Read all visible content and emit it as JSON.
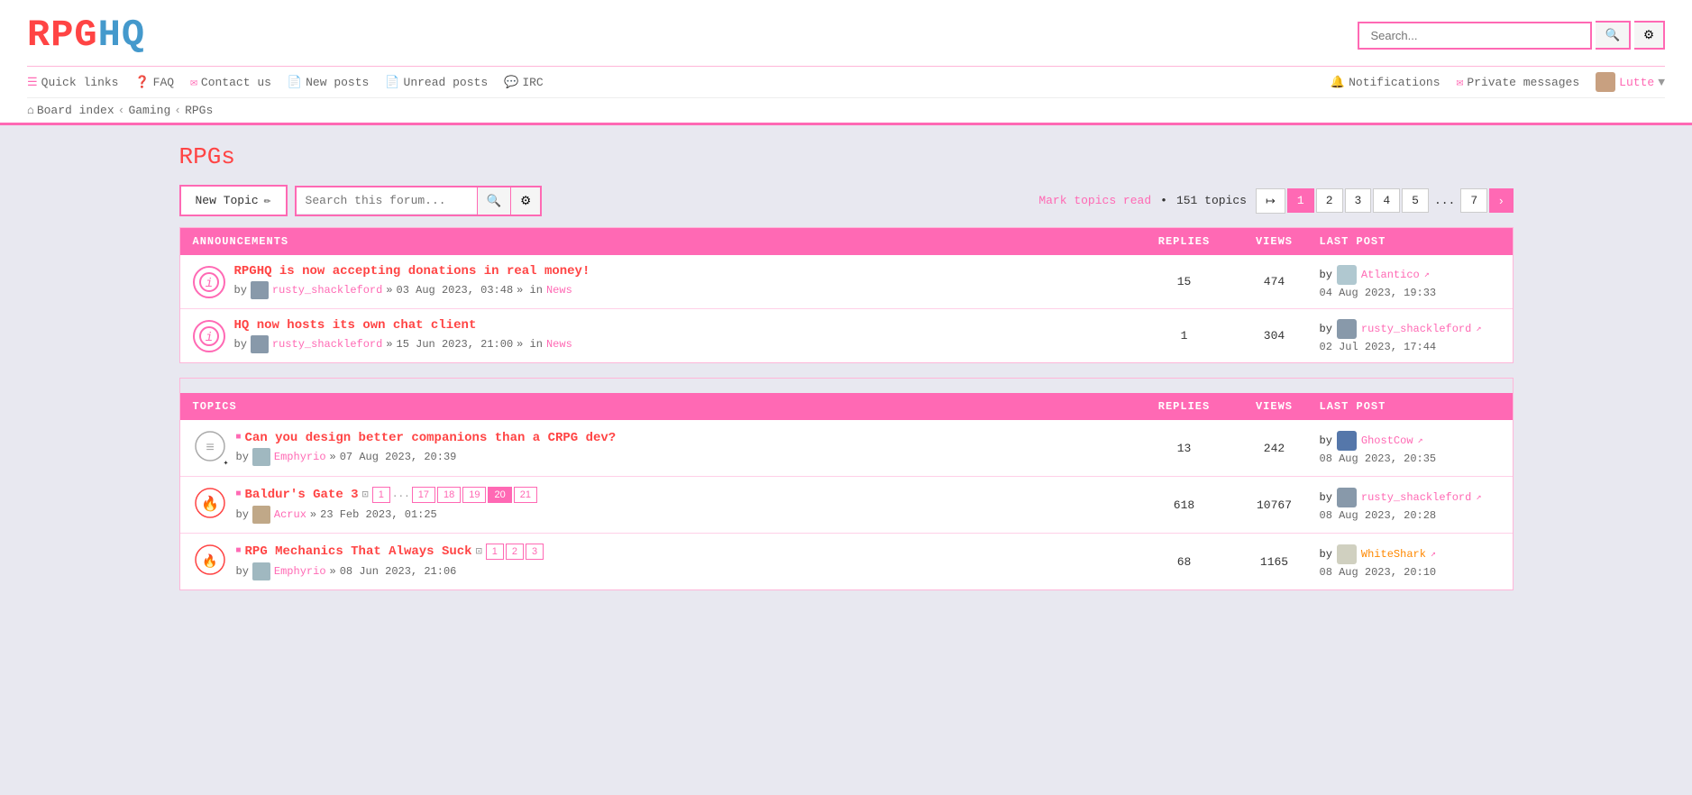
{
  "logo": {
    "rpg": "RPG",
    "hq": "HQ"
  },
  "search": {
    "placeholder": "Search...",
    "search_label": "🔍",
    "settings_label": "⚙"
  },
  "nav": {
    "left": [
      {
        "id": "quick-links",
        "icon": "☰",
        "label": "Quick links"
      },
      {
        "id": "faq",
        "icon": "❓",
        "label": "FAQ"
      },
      {
        "id": "contact",
        "icon": "✉",
        "label": "Contact us"
      },
      {
        "id": "new-posts",
        "icon": "📄",
        "label": "New posts"
      },
      {
        "id": "unread-posts",
        "icon": "📄",
        "label": "Unread posts"
      },
      {
        "id": "irc",
        "icon": "💬",
        "label": "IRC"
      }
    ],
    "right": [
      {
        "id": "notifications",
        "icon": "🔔",
        "label": "Notifications"
      },
      {
        "id": "private-messages",
        "icon": "✉",
        "label": "Private messages"
      },
      {
        "id": "user",
        "label": "Lutte",
        "dropdown": "▼"
      }
    ]
  },
  "breadcrumb": [
    {
      "label": "Board index",
      "icon": "⌂"
    },
    {
      "label": "Gaming"
    },
    {
      "label": "RPGs"
    }
  ],
  "page": {
    "title": "RPGs",
    "new_topic_label": "New Topic",
    "new_topic_icon": "✏",
    "search_forum_placeholder": "Search this forum...",
    "mark_topics_read": "Mark topics read",
    "topics_count": "151 topics",
    "pagination": {
      "first_icon": "↦",
      "pages": [
        "1",
        "2",
        "3",
        "4",
        "5"
      ],
      "dots": "...",
      "last": "7",
      "next": "›"
    }
  },
  "announcements": {
    "header_label": "ANNOUNCEMENTS",
    "replies_label": "REPLIES",
    "views_label": "VIEWS",
    "last_post_label": "LAST POST",
    "items": [
      {
        "title": "RPGHQ is now accepting donations in real money!",
        "author": "rusty_shackleford",
        "date": "03 Aug 2023, 03:48",
        "category": "News",
        "replies": "15",
        "views": "474",
        "last_post_by": "Atlantico",
        "last_post_date": "04 Aug 2023, 19:33"
      },
      {
        "title": "HQ now hosts its own chat client",
        "author": "rusty_shackleford",
        "date": "15 Jun 2023, 21:00",
        "category": "News",
        "replies": "1",
        "views": "304",
        "last_post_by": "rusty_shackleford",
        "last_post_date": "02 Jul 2023, 17:44"
      }
    ]
  },
  "topics": {
    "header_label": "TOPICS",
    "replies_label": "REPLIES",
    "views_label": "VIEWS",
    "last_post_label": "LAST POST",
    "items": [
      {
        "title": "Can you design better companions than a CRPG dev?",
        "author": "Emphyrio",
        "date": "07 Aug 2023, 20:39",
        "replies": "13",
        "views": "242",
        "last_post_by": "GhostCow",
        "last_post_date": "08 Aug 2023, 20:35",
        "pages": []
      },
      {
        "title": "Baldur's Gate 3",
        "author": "Acrux",
        "date": "23 Feb 2023, 01:25",
        "replies": "618",
        "views": "10767",
        "last_post_by": "rusty_shackleford",
        "last_post_date": "08 Aug 2023, 20:28",
        "pages": [
          "1",
          "...",
          "17",
          "18",
          "19",
          "20",
          "21"
        ]
      },
      {
        "title": "RPG Mechanics That Always Suck",
        "author": "Emphyrio",
        "date": "08 Jun 2023, 21:06",
        "replies": "68",
        "views": "1165",
        "last_post_by": "WhiteShark",
        "last_post_date": "08 Aug 2023, 20:10",
        "pages": [
          "1",
          "2",
          "3"
        ]
      }
    ]
  }
}
